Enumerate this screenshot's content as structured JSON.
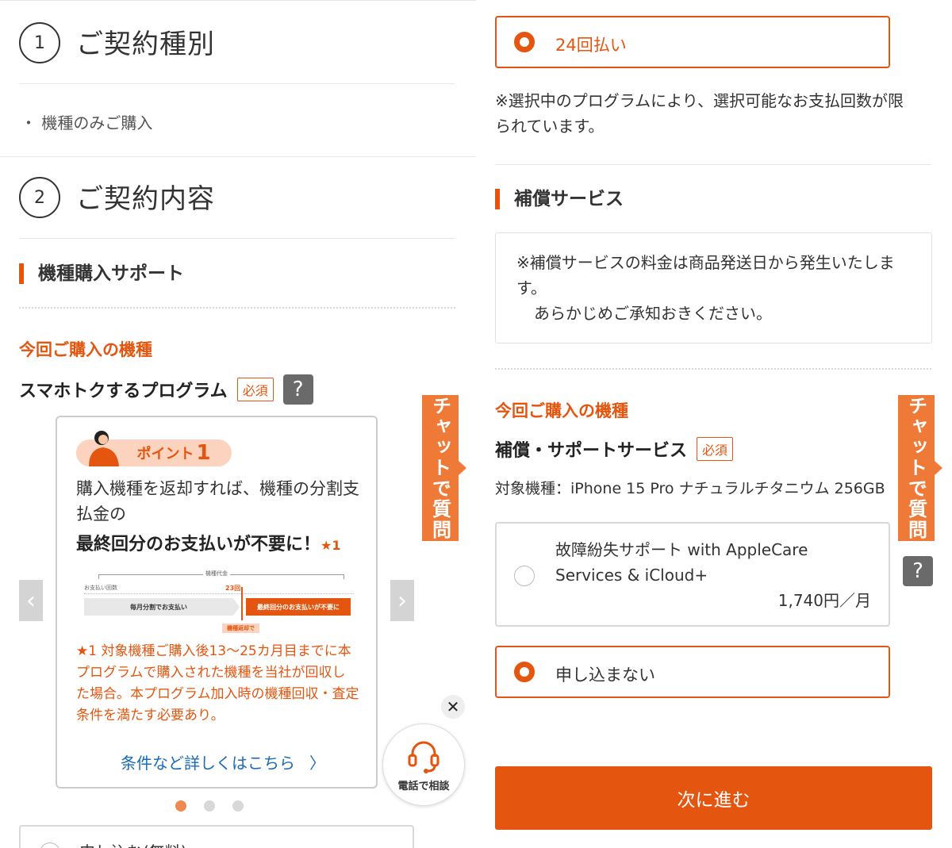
{
  "left": {
    "step1": {
      "num": "1",
      "title": "ご契約種別",
      "item": "・ 機種のみご購入"
    },
    "step2": {
      "num": "2",
      "title": "ご契約内容"
    },
    "support_heading": "機種購入サポート",
    "device_heading": "今回ご購入の機種",
    "program": {
      "title": "スマホトクするプログラム",
      "required": "必須",
      "help": "?"
    },
    "card": {
      "point_label": "ポイント",
      "point_num": "1",
      "text_line1": "購入機種を返却すれば、機種の分割支",
      "text_line2": "払金の",
      "bold_text": "最終回分のお支払いが不要に！",
      "bold_star": "★1",
      "diagram": {
        "top_label": "機種代金",
        "left_label": "お支払い回数",
        "month_label": "23回",
        "gray_label": "毎月分割でお支払い",
        "orange_label": "最終回分のお支払いが不要に",
        "return_label": "機種返却で"
      },
      "note_line1": "★1 対象機種ご購入後13〜25カ月目までに本",
      "note_line2": "プログラムで購入された機種を当社が回収し",
      "note_line3": "た場合。本プログラム加入時の機種回収・査定",
      "note_line4": "条件を満たす必要あり。",
      "link": "条件など詳しくはこちら",
      "link_chevron": "〉"
    },
    "nav": {
      "prev": "‹",
      "next": "›"
    },
    "bottom_option": "申し込む(無料)",
    "chat_tab": "チャットで質問",
    "phone": {
      "label": "電話で相談",
      "close": "✕"
    }
  },
  "right": {
    "installment_option": "24回払い",
    "installment_note": "※選択中のプログラムにより、選択可能なお支払回数が限られています。",
    "installment_note_line1": "※選択中のプログラムにより、選択可能なお支払回数が限",
    "installment_note_line2": "られています。",
    "warranty_heading": "補償サービス",
    "warranty_note_line1": "※補償サービスの料金は商品発送日から発生いたしま",
    "warranty_note_line2": "す。",
    "warranty_note_line3": "あらかじめご承知おきください。",
    "device_heading": "今回ご購入の機種",
    "service": {
      "title": "補償・サポートサービス",
      "required": "必須"
    },
    "target_device": "対象機種：iPhone 15 Pro ナチュラルチタニウム 256GB",
    "applecare": {
      "line1": "故障紛失サポート with AppleCare",
      "line2": "Services & iCloud+",
      "price": "1,740円／月",
      "help": "?"
    },
    "decline_option": "申し込まない",
    "next_button": "次に進む",
    "chat_tab": "チャットで質問"
  },
  "colors": {
    "accent": "#e4560f",
    "chat_tab": "#ef7a38",
    "link": "#1a6bb5"
  },
  "icons": [
    "question-icon",
    "chevron-left-icon",
    "chevron-right-icon",
    "headset-icon",
    "close-icon",
    "radio-selected-icon",
    "radio-unselected-icon"
  ]
}
